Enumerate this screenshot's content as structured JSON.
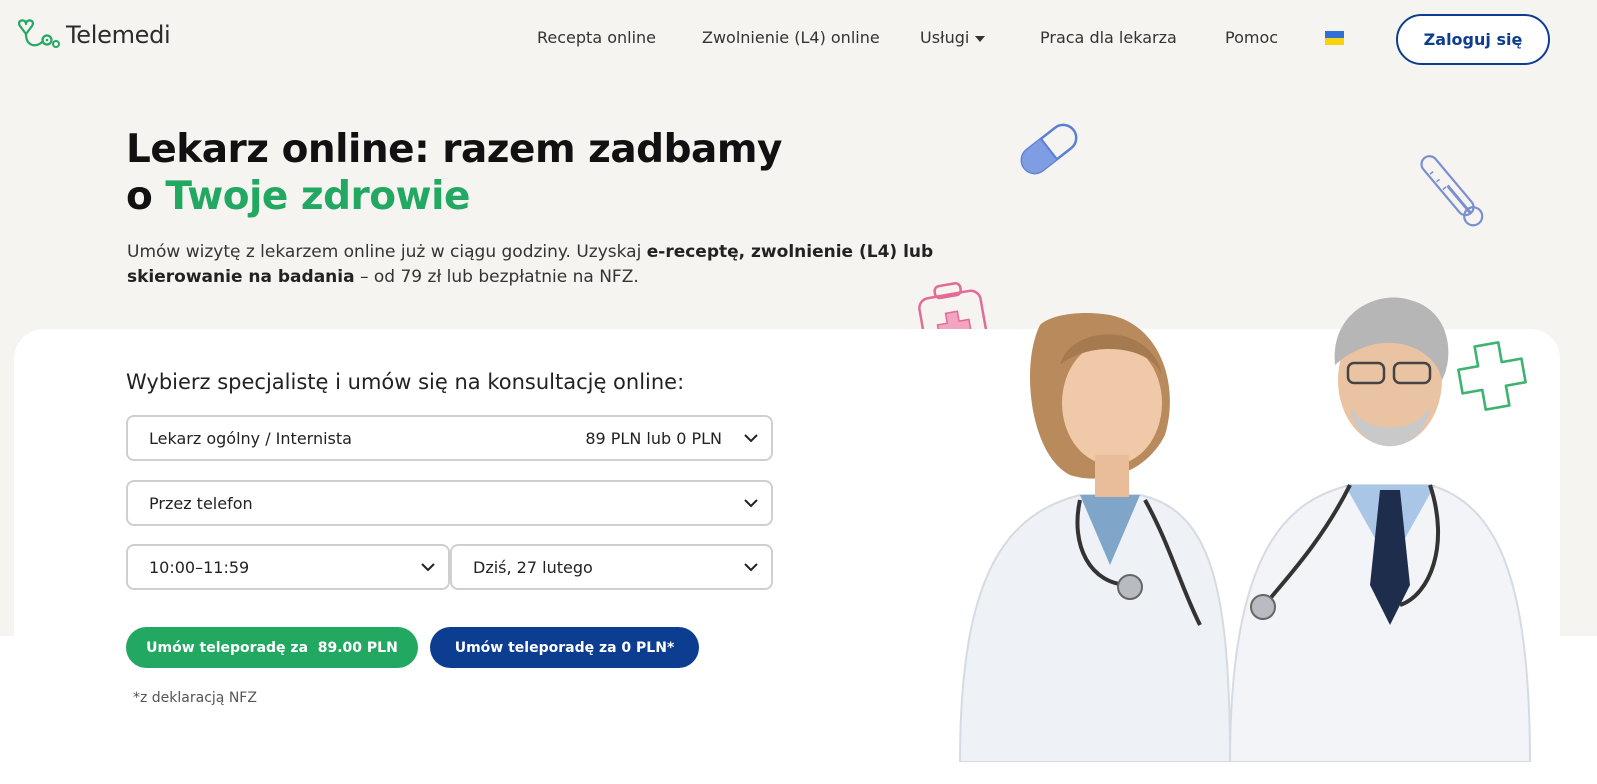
{
  "brand": {
    "name": "Telemedi",
    "primary_green": "#23a862",
    "primary_blue": "#0d3d91"
  },
  "nav": {
    "items": [
      "Recepta online",
      "Zwolnienie (L4) online",
      "Usługi",
      "Praca dla lekarza",
      "Pomoc"
    ],
    "login_label": "Zaloguj się",
    "language_flag": "ukraine-flag-icon"
  },
  "hero": {
    "title_line1": "Lekarz online: razem zadbamy",
    "title_line2_prefix": "o ",
    "title_line2_highlight": "Twoje zdrowie",
    "desc_part1": "Umów wizytę z lekarzem online już w ciągu godziny. Uzyskaj ",
    "desc_bold": "e-receptę, zwolnienie (L4) lub skierowanie na badania",
    "desc_part2": " – od 79 zł lub bezpłatnie na NFZ."
  },
  "booking": {
    "title": "Wybierz specjalistę i umów się na konsultację online:",
    "specialist": {
      "value": "Lekarz ogólny / Internista",
      "price": "89 PLN lub 0 PLN"
    },
    "channel": {
      "value": "Przez telefon"
    },
    "time": {
      "value": "10:00–11:59"
    },
    "date": {
      "value": "Dziś, 27 lutego"
    },
    "btn_paid": "Umów teleporadę za  89.00 PLN",
    "btn_free": "Umów teleporadę za 0 PLN*",
    "note": "*z deklaracją NFZ"
  }
}
